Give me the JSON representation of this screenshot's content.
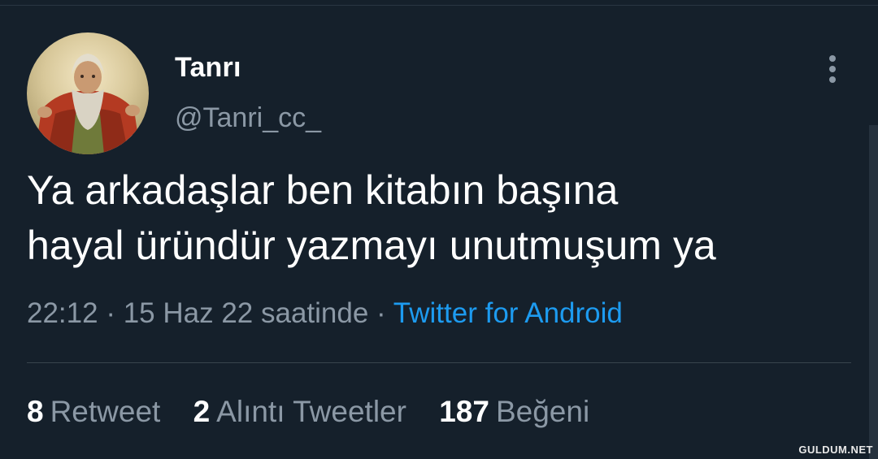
{
  "user": {
    "display_name": "Tanrı",
    "handle": "@Tanri_cc_"
  },
  "tweet": {
    "text_lines": [
      "Ya arkadaşlar ben kitabın başına",
      "hayal üründür yazmayı unutmuşum ya"
    ],
    "time": "22:12",
    "date": "15 Haz 22 saatinde",
    "separator": " · ",
    "source": "Twitter for Android"
  },
  "stats": {
    "retweets": {
      "count": "8",
      "label": "Retweet"
    },
    "quotes": {
      "count": "2",
      "label": "Alıntı Tweetler"
    },
    "likes": {
      "count": "187",
      "label": "Beğeni"
    }
  },
  "icons": {
    "more": "more-vertical-icon"
  },
  "watermark": "GULDUM.NET",
  "colors": {
    "background": "#15202b",
    "primary_text": "#ffffff",
    "secondary_text": "#8b98a5",
    "link": "#1d9bf0",
    "divider": "#38444d"
  }
}
